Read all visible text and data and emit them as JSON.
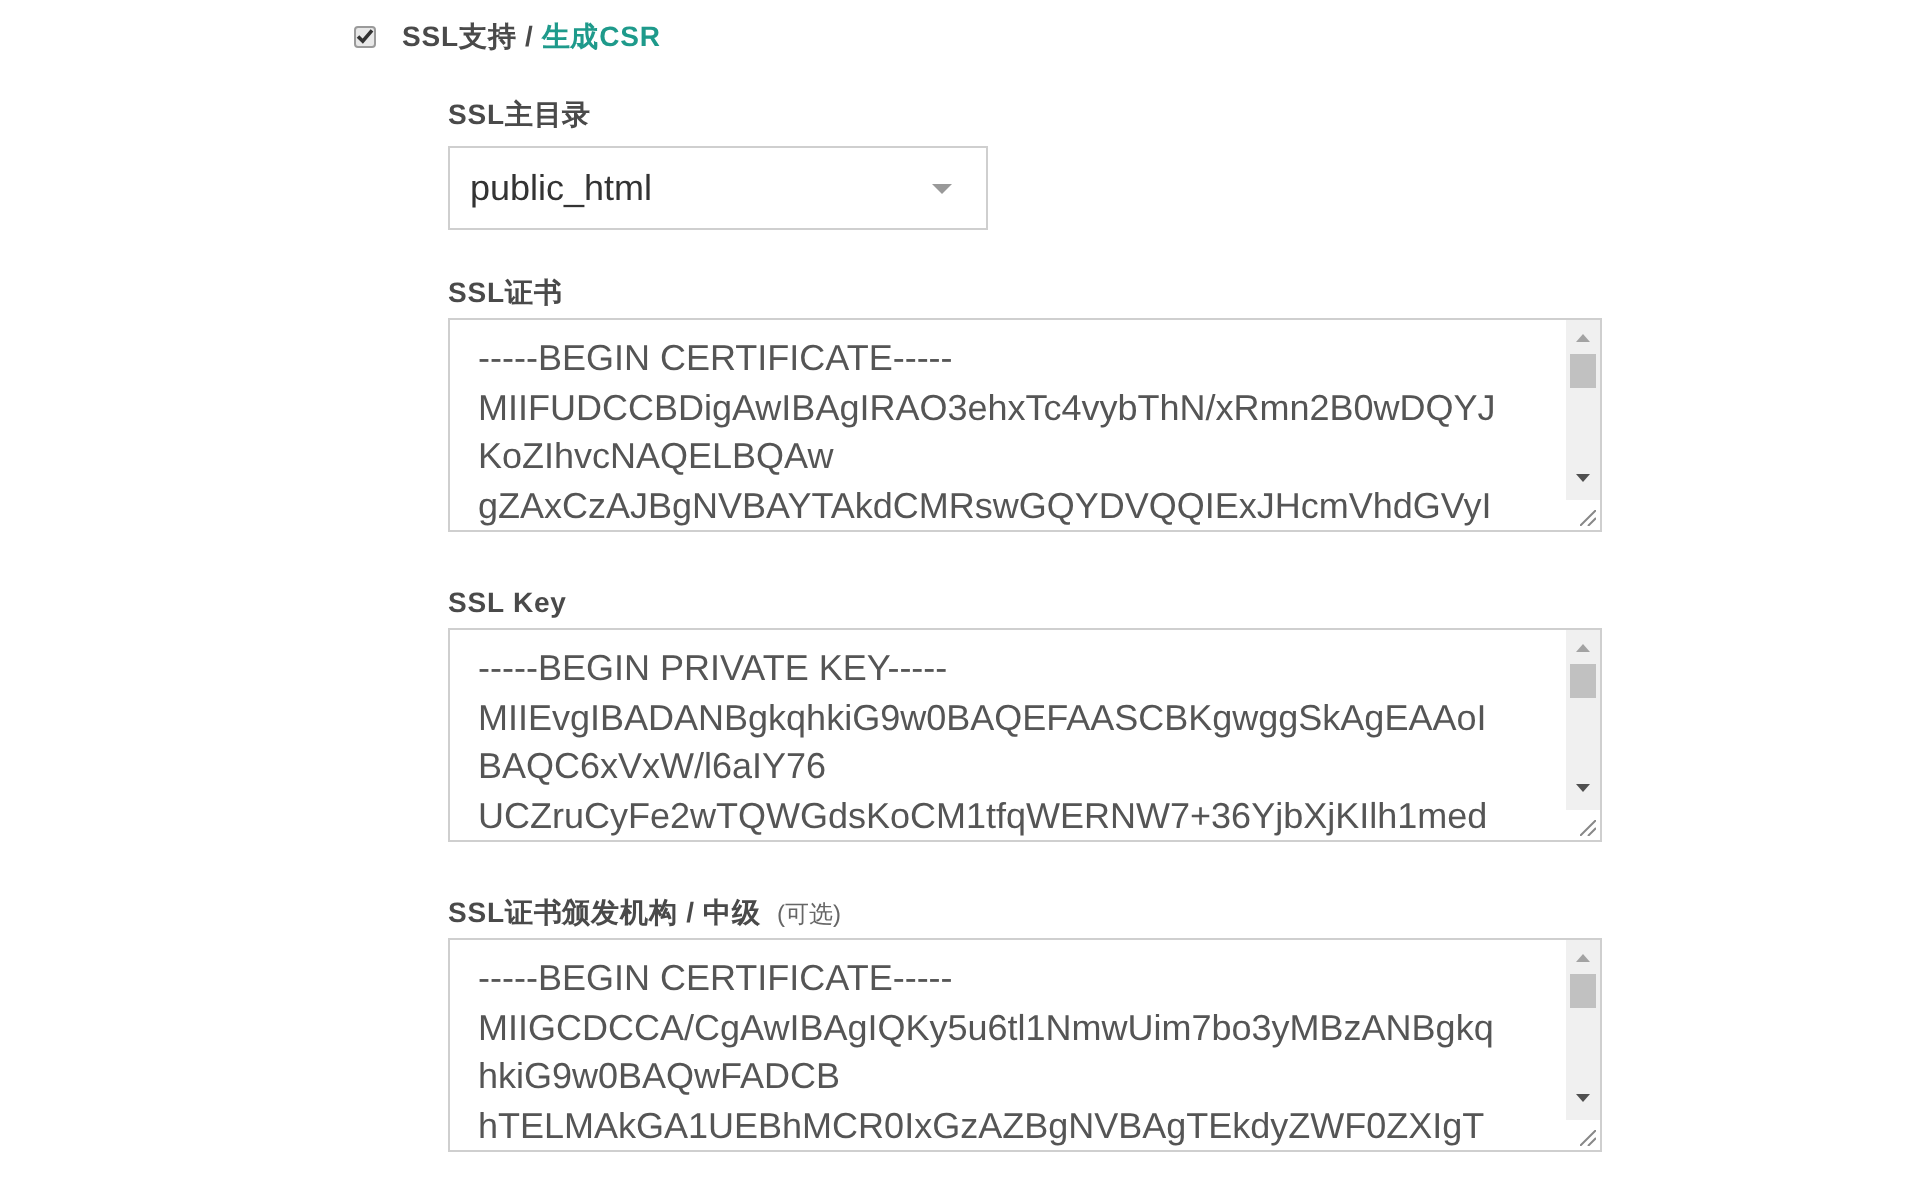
{
  "ssl_option": {
    "checked": true,
    "label": "SSL支持 /",
    "link": "生成CSR"
  },
  "fields": [
    {
      "kind": "select",
      "label": "SSL主目录",
      "value": "public_html"
    },
    {
      "kind": "textarea",
      "label": "SSL证书",
      "lines": [
        "-----BEGIN CERTIFICATE-----",
        "MIIFUDCCBDigAwIBAgIRAO3ehxTc4vybThN/xRmn2B0wDQYJ",
        "KoZIhvcNAQELBQAw",
        "gZAxCzAJBgNVBAYTAkdCMRswGQYDVQQIExJHcmVhdGVyI"
      ]
    },
    {
      "kind": "textarea",
      "label": "SSL Key",
      "lines": [
        "-----BEGIN PRIVATE KEY-----",
        "MIIEvgIBADANBgkqhkiG9w0BAQEFAASCBKgwggSkAgEAAoI",
        "BAQC6xVxW/l6aIY76",
        "UCZruCyFe2wTQWGdsKoCM1tfqWERNW7+36YjbXjKIlh1med"
      ]
    },
    {
      "kind": "textarea",
      "label": "SSL证书颁发机构 / 中级",
      "hint": "(可选)",
      "lines": [
        "-----BEGIN CERTIFICATE-----",
        "MIIGCDCCA/CgAwIBAgIQKy5u6tl1NmwUim7bo3yMBzANBgkq",
        "hkiG9w0BAQwFADCB",
        "hTELMAkGA1UEBhMCR0IxGzAZBgNVBAgTEkdyZWF0ZXIgT"
      ]
    }
  ]
}
